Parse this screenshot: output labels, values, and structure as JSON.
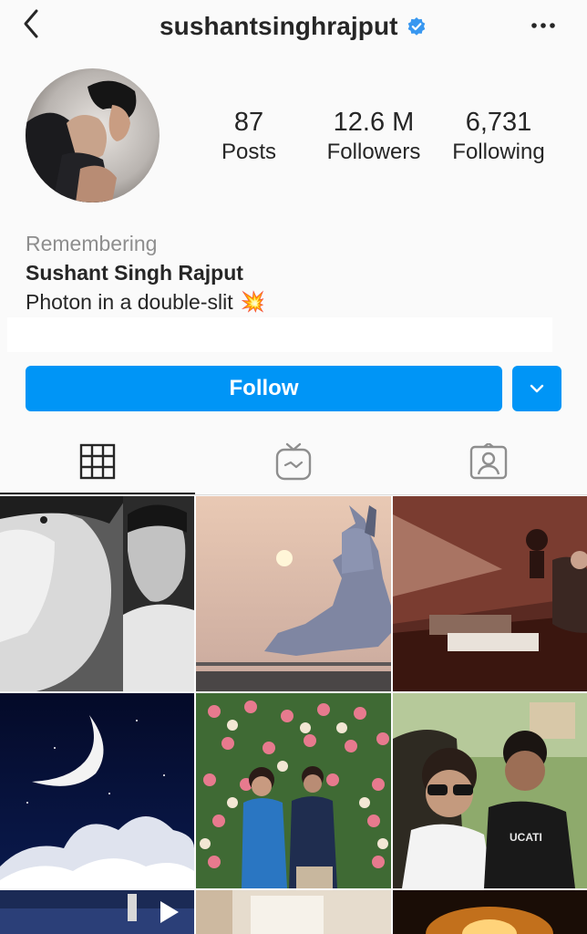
{
  "header": {
    "username": "sushantsinghrajput",
    "verified": true,
    "back_icon": "chevron-left-icon",
    "more_icon": "more-horizontal-icon"
  },
  "stats": {
    "posts_value": "87",
    "posts_label": "Posts",
    "followers_value": "12.6 M",
    "followers_label": "Followers",
    "following_value": "6,731",
    "following_label": "Following"
  },
  "bio": {
    "category": "Remembering",
    "name": "Sushant Singh Rajput",
    "tagline": "Photon in a double-slit",
    "tagline_emoji": "💥"
  },
  "actions": {
    "follow_label": "Follow",
    "dropdown_icon": "chevron-down-icon"
  },
  "tabs": [
    {
      "name": "grid-icon",
      "active": true
    },
    {
      "name": "igtv-icon",
      "active": false
    },
    {
      "name": "tagged-icon",
      "active": false
    }
  ],
  "colors": {
    "accent": "#0095f6",
    "verified": "#3897f0",
    "muted_text": "#8e8e8e",
    "primary_text": "#262626"
  }
}
